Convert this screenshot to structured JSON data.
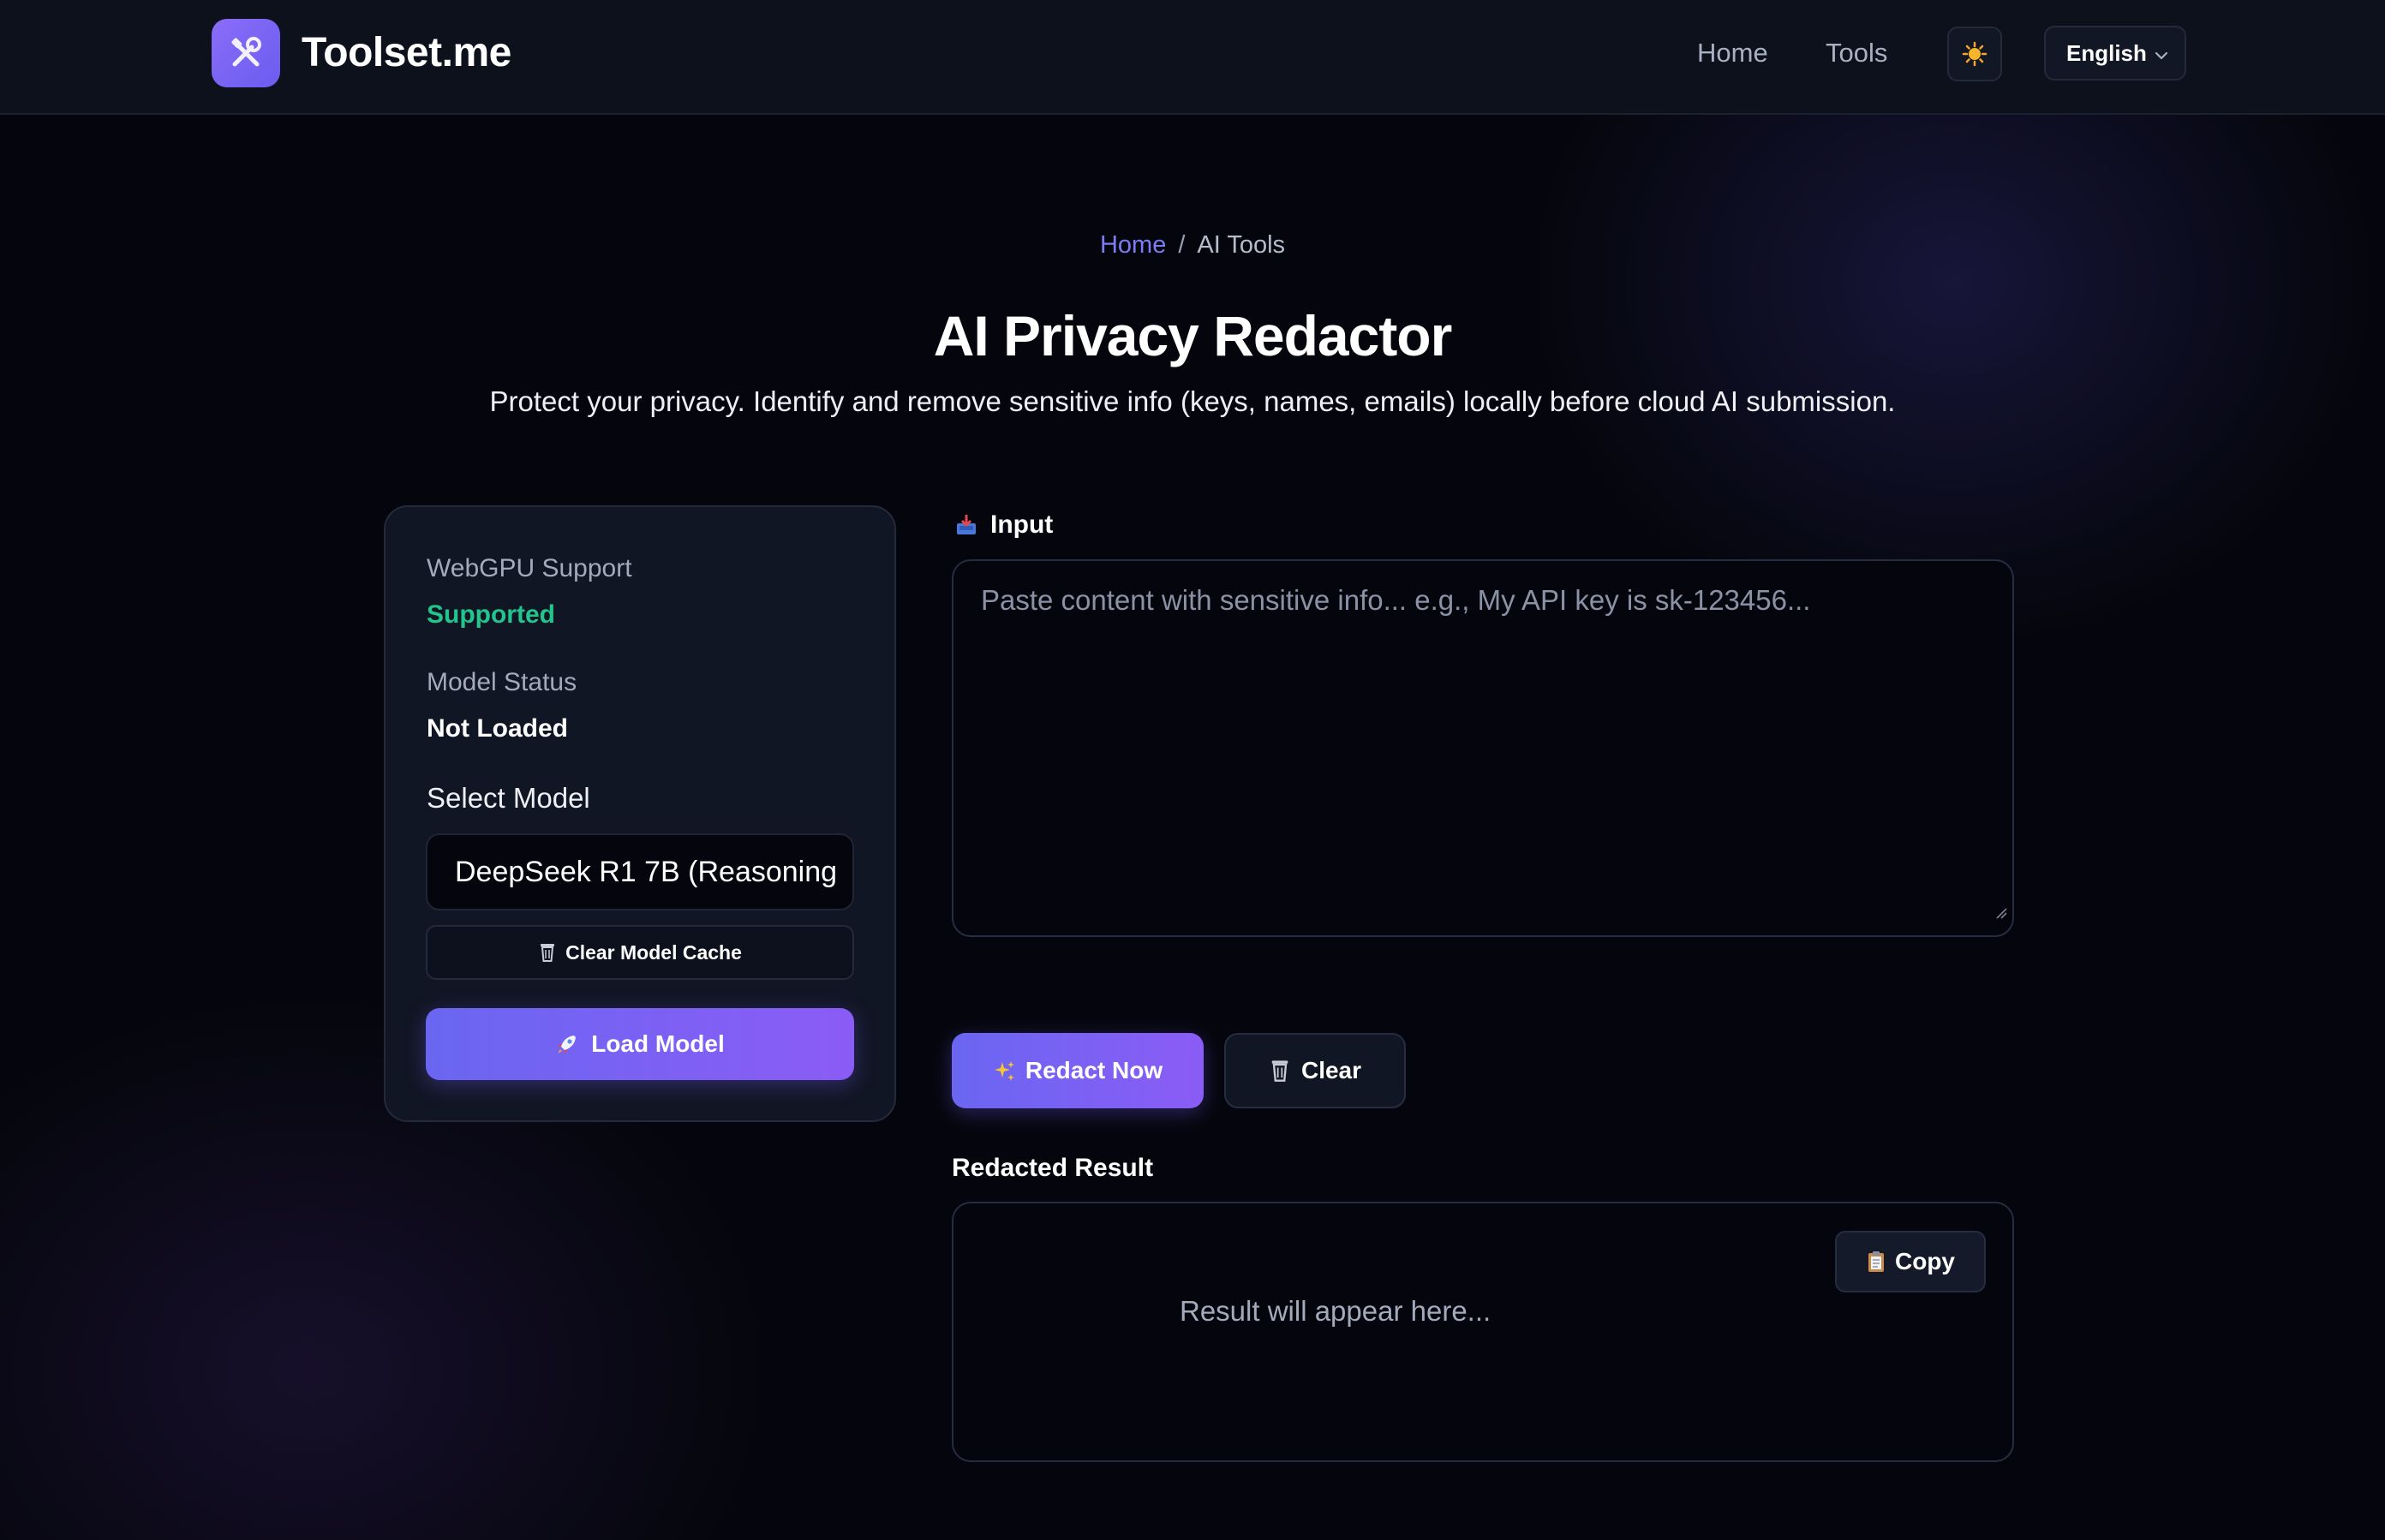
{
  "header": {
    "brand": "Toolset.me",
    "logo_icon": "tools-icon",
    "nav": [
      {
        "label": "Home"
      },
      {
        "label": "Tools"
      }
    ],
    "theme_icon": "sun-icon",
    "language": "English"
  },
  "breadcrumb": {
    "home": "Home",
    "separator": "/",
    "current": "AI Tools"
  },
  "hero": {
    "title": "AI Privacy Redactor",
    "subtitle": "Protect your privacy. Identify and remove sensitive info (keys, names, emails) locally before cloud AI submission."
  },
  "panel": {
    "webgpu_label": "WebGPU Support",
    "webgpu_value": "Supported",
    "model_status_label": "Model Status",
    "model_status_value": "Not Loaded",
    "select_model_label": "Select Model",
    "selected_model": "DeepSeek R1 7B (Reasoning",
    "clear_cache_label": "Clear Model Cache",
    "load_model_label": "Load Model"
  },
  "input": {
    "label": "Input",
    "placeholder": "Paste content with sensitive info... e.g., My API key is sk-123456..."
  },
  "actions": {
    "redact_label": "Redact Now",
    "clear_label": "Clear"
  },
  "result": {
    "label": "Redacted Result",
    "placeholder": "Result will appear here...",
    "copy_label": "Copy"
  },
  "colors": {
    "accent": "#6a66f2",
    "accent_2": "#8b5cf6",
    "success": "#22c58b",
    "link": "#7c7cf5",
    "background": "#05060d"
  }
}
